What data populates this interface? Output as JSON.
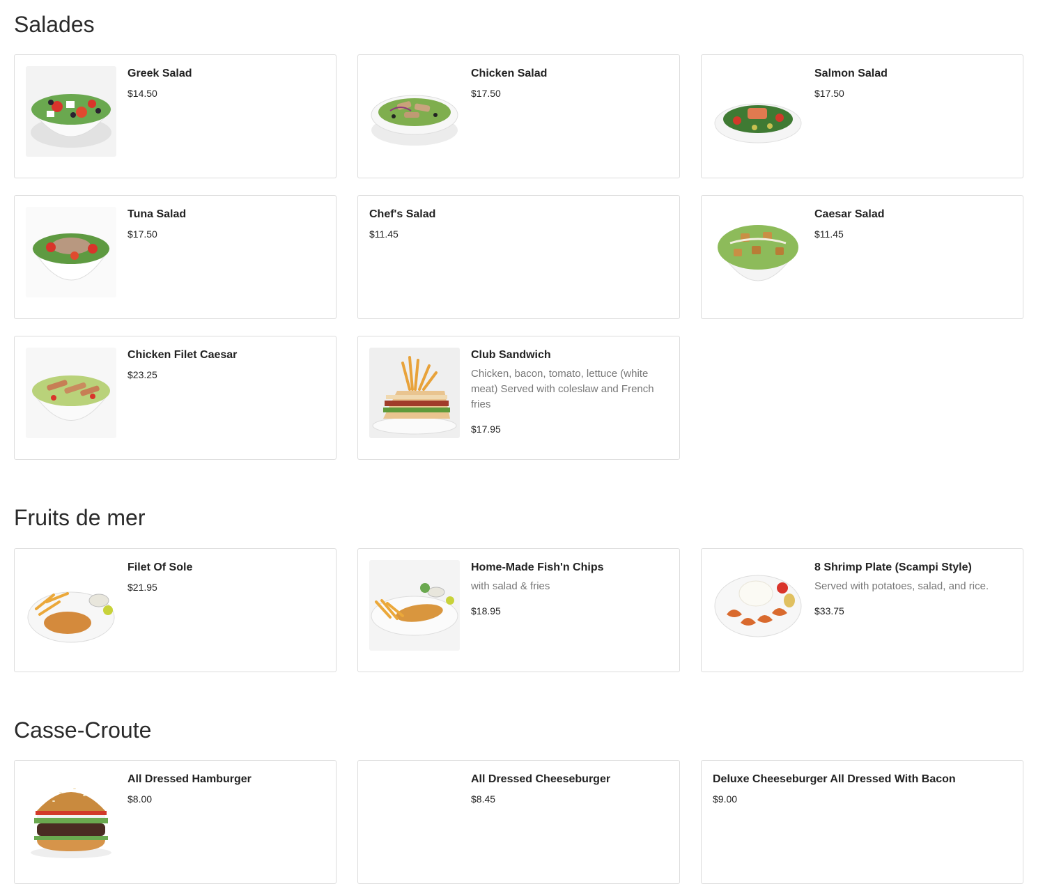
{
  "sections": [
    {
      "title": "Salades",
      "items": [
        {
          "name": "Greek Salad",
          "desc": "",
          "price": "$14.50",
          "icon": "greek-salad-photo"
        },
        {
          "name": "Chicken Salad",
          "desc": "",
          "price": "$17.50",
          "icon": "chicken-salad-photo"
        },
        {
          "name": "Salmon Salad",
          "desc": "",
          "price": "$17.50",
          "icon": "salmon-salad-photo"
        },
        {
          "name": "Tuna Salad",
          "desc": "",
          "price": "$17.50",
          "icon": "tuna-salad-photo"
        },
        {
          "name": "Chef's Salad",
          "desc": "",
          "price": "$11.45",
          "icon": ""
        },
        {
          "name": "Caesar Salad",
          "desc": "",
          "price": "$11.45",
          "icon": "caesar-salad-photo"
        },
        {
          "name": "Chicken Filet Caesar",
          "desc": "",
          "price": "$23.25",
          "icon": "chicken-filet-caesar-photo"
        },
        {
          "name": "Club Sandwich",
          "desc": "Chicken, bacon, tomato, lettuce (white meat) Served with coleslaw and French fries",
          "price": "$17.95",
          "icon": "club-sandwich-photo"
        }
      ]
    },
    {
      "title": "Fruits de mer",
      "items": [
        {
          "name": "Filet Of Sole",
          "desc": "",
          "price": "$21.95",
          "icon": "filet-of-sole-photo"
        },
        {
          "name": "Home-Made Fish'n Chips",
          "desc": "with salad & fries",
          "price": "$18.95",
          "icon": "fish-and-chips-photo"
        },
        {
          "name": "8 Shrimp Plate (Scampi Style)",
          "desc": "Served with potatoes, salad, and rice.",
          "price": "$33.75",
          "icon": "shrimp-plate-photo"
        }
      ]
    },
    {
      "title": "Casse-Croute",
      "items": [
        {
          "name": "All Dressed Hamburger",
          "desc": "",
          "price": "$8.00",
          "icon": "hamburger-photo"
        },
        {
          "name": "All Dressed Cheeseburger",
          "desc": "",
          "price": "$8.45",
          "icon": "blank-thumb"
        },
        {
          "name": "Deluxe Cheeseburger All Dressed With Bacon",
          "desc": "",
          "price": "$9.00",
          "icon": ""
        }
      ]
    }
  ]
}
